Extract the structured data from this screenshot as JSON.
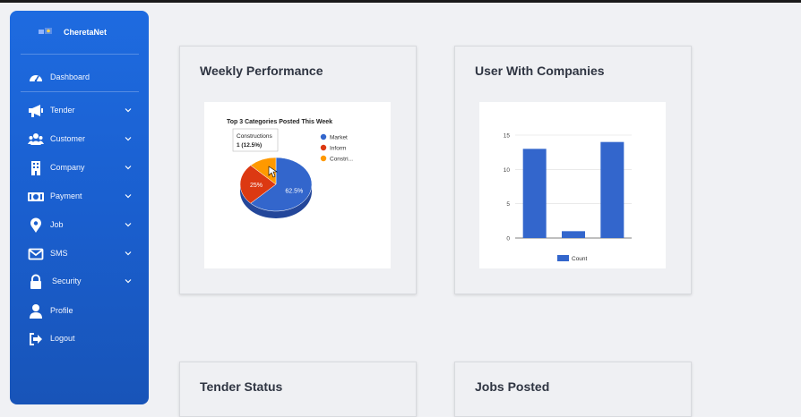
{
  "app": {
    "brand": "CheretaNet"
  },
  "sidebar": {
    "items": [
      {
        "label": "Dashboard",
        "icon": "speedometer-icon",
        "has_submenu": false
      },
      {
        "label": "Tender",
        "icon": "megaphone-icon",
        "has_submenu": true
      },
      {
        "label": "Customer",
        "icon": "users-icon",
        "has_submenu": true
      },
      {
        "label": "Company",
        "icon": "building-icon",
        "has_submenu": true
      },
      {
        "label": "Payment",
        "icon": "money-icon",
        "has_submenu": true
      },
      {
        "label": "Job",
        "icon": "map-pin-icon",
        "has_submenu": true
      },
      {
        "label": "SMS",
        "icon": "envelope-icon",
        "has_submenu": true
      },
      {
        "label": "Security",
        "icon": "lock-icon",
        "has_submenu": true
      },
      {
        "label": "Profile",
        "icon": "user-icon",
        "has_submenu": false
      },
      {
        "label": "Logout",
        "icon": "logout-icon",
        "has_submenu": false
      }
    ]
  },
  "cards": {
    "weekly": {
      "title": "Weekly Performance"
    },
    "companies": {
      "title": "User With Companies"
    },
    "tender": {
      "title": "Tender Status"
    },
    "jobs": {
      "title": "Jobs Posted"
    }
  },
  "colors": {
    "blue": "#3366cc",
    "red": "#dc3912",
    "orange": "#ff9900",
    "sidebar": "#1a5fcf"
  },
  "chart_data": [
    {
      "type": "pie",
      "title": "Top 3 Categories Posted This Week",
      "slices": [
        {
          "name": "Market",
          "value": 5,
          "label": "62.5%"
        },
        {
          "name": "Inform",
          "value": 2,
          "label": "25%"
        },
        {
          "name": "Constri...",
          "value": 1,
          "label": ""
        }
      ],
      "legend": [
        "Market",
        "Inform",
        "Constri..."
      ],
      "legend_position": "right",
      "tooltip": {
        "title": "Constructions",
        "value": "1 (12.5%)"
      }
    },
    {
      "type": "bar",
      "categories": [
        "",
        "",
        ""
      ],
      "series": [
        {
          "name": "Count",
          "values": [
            13,
            1,
            14
          ]
        }
      ],
      "ylim": [
        0,
        15
      ],
      "yticks": [
        "15",
        "10",
        "5",
        "0"
      ],
      "legend_position": "bottom",
      "grid": true
    }
  ]
}
